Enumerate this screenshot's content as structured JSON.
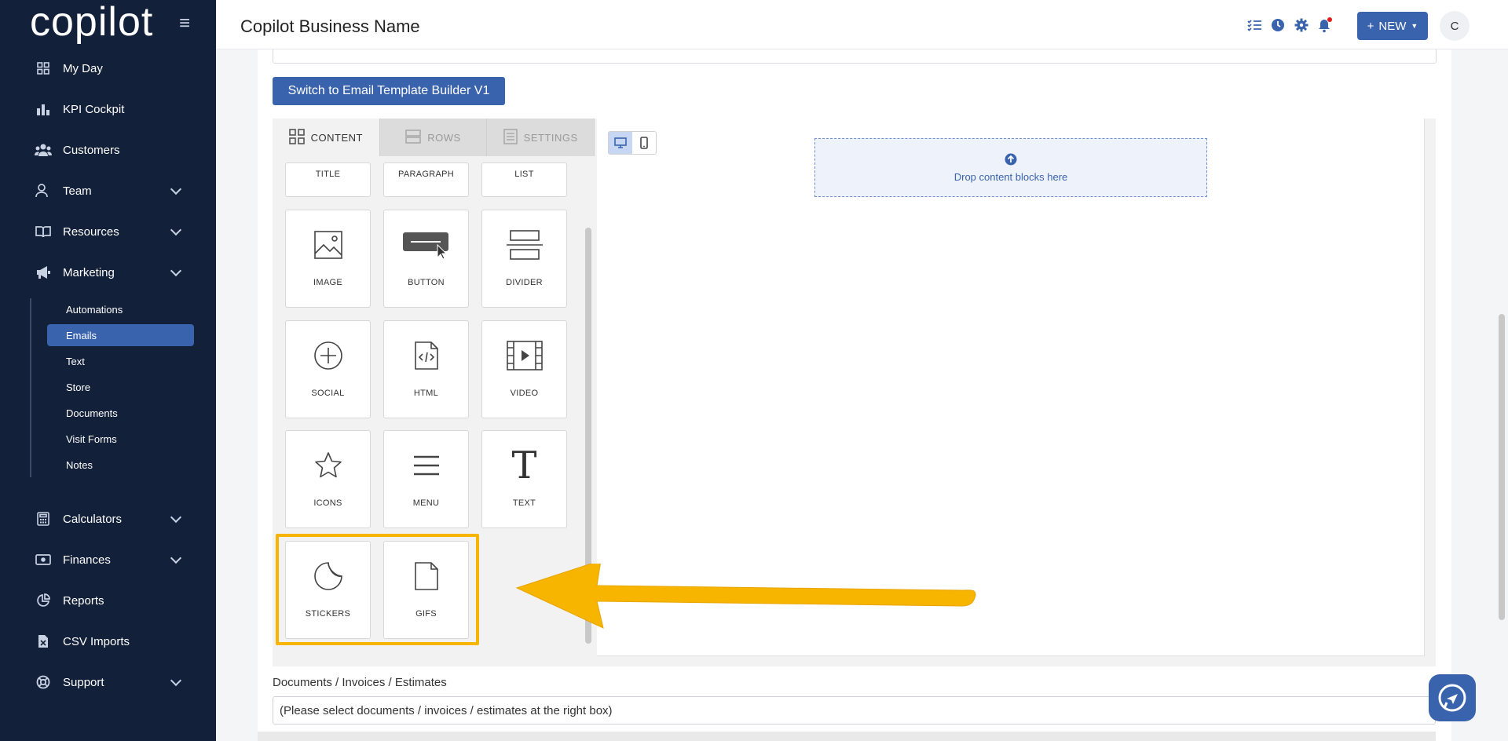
{
  "app": {
    "logo_text": "copilot",
    "business_name": "Copilot Business Name"
  },
  "sidebar": {
    "items": [
      {
        "label": "My Day",
        "icon": "grid-icon"
      },
      {
        "label": "KPI Cockpit",
        "icon": "bar-chart-icon"
      },
      {
        "label": "Customers",
        "icon": "users-icon"
      },
      {
        "label": "Team",
        "icon": "user-icon"
      },
      {
        "label": "Resources",
        "icon": "book-icon"
      },
      {
        "label": "Marketing",
        "icon": "megaphone-icon"
      },
      {
        "label": "Calculators",
        "icon": "calculator-icon"
      },
      {
        "label": "Finances",
        "icon": "money-icon"
      },
      {
        "label": "Reports",
        "icon": "pie-chart-icon"
      },
      {
        "label": "CSV Imports",
        "icon": "file-csv-icon"
      },
      {
        "label": "Support",
        "icon": "lifebuoy-icon"
      }
    ],
    "marketing_sub": [
      "Automations",
      "Emails",
      "Text",
      "Store",
      "Documents",
      "Visit Forms",
      "Notes"
    ],
    "active_sub": "Emails"
  },
  "header": {
    "new_label": "NEW",
    "avatar_initial": "C"
  },
  "main": {
    "switch_button": "Switch to Email Template Builder V1",
    "tabs": [
      "CONTENT",
      "ROWS",
      "SETTINGS"
    ],
    "blocks_partial": [
      "TITLE",
      "PARAGRAPH",
      "LIST"
    ],
    "blocks": [
      "IMAGE",
      "BUTTON",
      "DIVIDER",
      "SOCIAL",
      "HTML",
      "VIDEO",
      "ICONS",
      "MENU",
      "TEXT",
      "STICKERS",
      "GIFS"
    ],
    "dropzone_text": "Drop content blocks here",
    "docs_label": "Documents / Invoices / Estimates",
    "docs_placeholder": "(Please select documents / invoices / estimates at the right box)"
  },
  "colors": {
    "sidebar_bg": "#12203a",
    "accent": "#3a63ad",
    "highlight": "#f7b500"
  }
}
